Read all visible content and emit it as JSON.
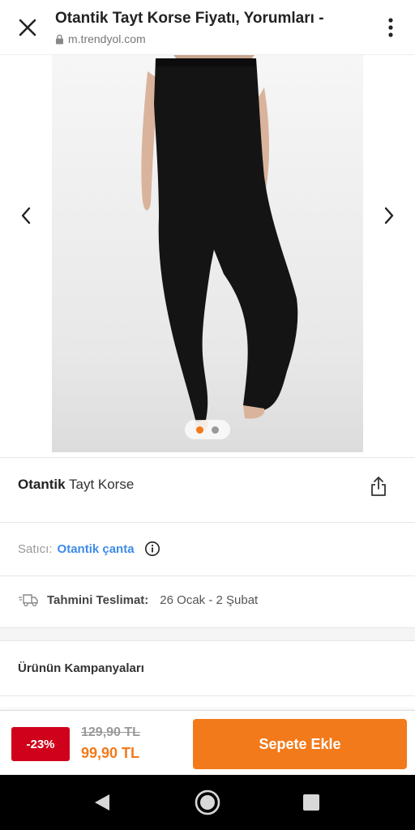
{
  "browser": {
    "title": "Otantik Tayt Korse Fiyatı, Yorumları -",
    "url": "m.trendyol.com"
  },
  "gallery": {
    "image_count": 2,
    "active_index": 0
  },
  "product": {
    "brand": "Otantik",
    "name": "Tayt Korse"
  },
  "seller": {
    "label": "Satıcı:",
    "name": "Otantik çanta"
  },
  "delivery": {
    "label": "Tahmini Teslimat:",
    "dates": "26 Ocak - 2 Şubat"
  },
  "campaigns": {
    "label": "Ürünün Kampanyaları"
  },
  "purchase": {
    "discount": "-23%",
    "old_price": "129,90 TL",
    "new_price": "99,90 TL",
    "add_to_cart": "Sepete Ekle"
  },
  "colors": {
    "accent": "#f27a1a",
    "discount_red": "#d0021b",
    "link_blue": "#3d8be8"
  },
  "icons": [
    "close-icon",
    "lock-icon",
    "more-vertical-icon",
    "chevron-left-icon",
    "chevron-right-icon",
    "share-icon",
    "info-icon",
    "truck-icon",
    "nav-back-icon",
    "nav-home-icon",
    "nav-recents-icon"
  ]
}
